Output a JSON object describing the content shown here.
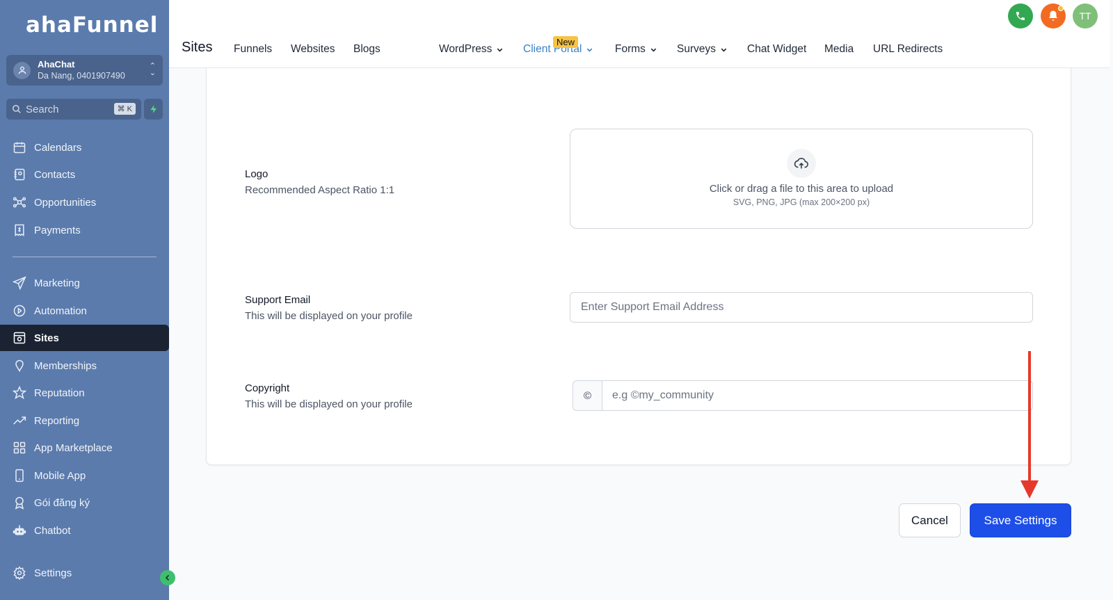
{
  "brand": {
    "logo_text": "ahaFunnel"
  },
  "account": {
    "name": "AhaChat",
    "subtitle": "Da Nang, 0401907490"
  },
  "search": {
    "placeholder": "Search",
    "shortcut": "⌘ K"
  },
  "sidebar": {
    "items": [
      {
        "label": "Calendars",
        "icon": "calendar-icon"
      },
      {
        "label": "Contacts",
        "icon": "contacts-icon"
      },
      {
        "label": "Opportunities",
        "icon": "opportunities-icon"
      },
      {
        "label": "Payments",
        "icon": "payments-icon"
      },
      {
        "label": "Marketing",
        "icon": "send-icon"
      },
      {
        "label": "Automation",
        "icon": "automation-icon"
      },
      {
        "label": "Sites",
        "icon": "sites-icon",
        "active": true
      },
      {
        "label": "Memberships",
        "icon": "memberships-icon"
      },
      {
        "label": "Reputation",
        "icon": "star-icon"
      },
      {
        "label": "Reporting",
        "icon": "trend-icon"
      },
      {
        "label": "App Marketplace",
        "icon": "grid-icon"
      },
      {
        "label": "Mobile App",
        "icon": "phone-device-icon"
      },
      {
        "label": "Gói đăng ký",
        "icon": "award-icon"
      },
      {
        "label": "Chatbot",
        "icon": "robot-icon"
      }
    ],
    "settings_label": "Settings"
  },
  "topbar": {
    "title": "Sites",
    "tabs": [
      {
        "label": "Funnels"
      },
      {
        "label": "Websites"
      },
      {
        "label": "Blogs",
        "badge": "New"
      },
      {
        "label": "WordPress",
        "dropdown": true
      },
      {
        "label": "Client Portal",
        "dropdown": true,
        "active": true
      },
      {
        "label": "Forms",
        "dropdown": true
      },
      {
        "label": "Surveys",
        "dropdown": true
      },
      {
        "label": "Chat Widget"
      },
      {
        "label": "Media"
      },
      {
        "label": "URL Redirects"
      }
    ],
    "avatar_initials": "TT"
  },
  "form": {
    "logo": {
      "label": "Logo",
      "description": "Recommended Aspect Ratio 1:1",
      "upload_text": "Click or drag a file to this area to upload",
      "upload_hint": "SVG, PNG, JPG (max 200×200 px)"
    },
    "support_email": {
      "label": "Support Email",
      "description": "This will be displayed on your profile",
      "placeholder": "Enter Support Email Address",
      "value": ""
    },
    "copyright": {
      "label": "Copyright",
      "description": "This will be displayed on your profile",
      "addon": "©",
      "placeholder": "e.g ©my_community",
      "value": ""
    }
  },
  "actions": {
    "cancel_label": "Cancel",
    "save_label": "Save Settings"
  },
  "colors": {
    "sidebar": "#5b7bad",
    "active_tab": "#3b82c4",
    "primary": "#1d4ee8",
    "annotation_arrow": "#e5392b"
  }
}
